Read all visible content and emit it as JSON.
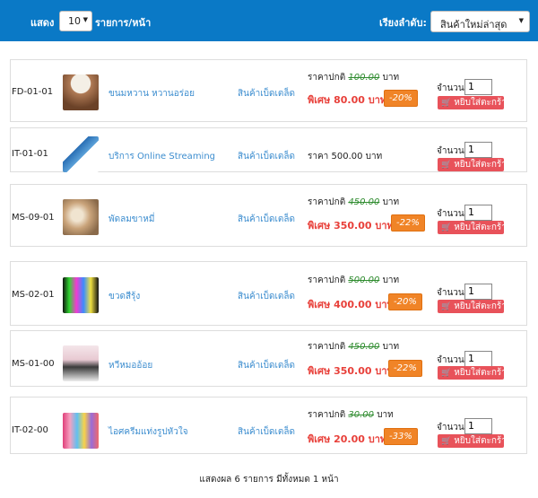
{
  "toolbar": {
    "show_label": "แสดง",
    "per_page_value": "10",
    "per_page_suffix": "รายการ/หน้า",
    "sort_label": "เรียงลำดับ:",
    "sort_value": "สินค้าใหม่ล่าสุด"
  },
  "labels": {
    "regular_price": "ราคาปกติ",
    "special_price": "พิเศษ",
    "price": "ราคา",
    "baht": "บาท",
    "quantity": "จำนวน",
    "add_to_cart": "หยิบใส่ตะกร้า"
  },
  "products": [
    {
      "code": "FD-01-01",
      "name": "ขนมหวาน หวานอร่อย",
      "category": "สินค้าเบ็ดเตล็ด",
      "regular": "100.00",
      "special": "80.00",
      "discount": "-20%",
      "qty": "1"
    },
    {
      "code": "IT-01-01",
      "name": "บริการ Online Streaming",
      "category": "สินค้าเบ็ดเตล็ด",
      "price": "500.00",
      "qty": "1"
    },
    {
      "code": "MS-09-01",
      "name": "พัดลมขาหมี่",
      "category": "สินค้าเบ็ดเตล็ด",
      "regular": "450.00",
      "special": "350.00",
      "discount": "-22%",
      "qty": "1"
    },
    {
      "code": "MS-02-01",
      "name": "ขวดสีรุ้ง",
      "category": "สินค้าเบ็ดเตล็ด",
      "regular": "500.00",
      "special": "400.00",
      "discount": "-20%",
      "qty": "1"
    },
    {
      "code": "MS-01-00",
      "name": "หวีหมออ้อย",
      "category": "สินค้าเบ็ดเตล็ด",
      "regular": "450.00",
      "special": "350.00",
      "discount": "-22%",
      "qty": "1"
    },
    {
      "code": "IT-02-00",
      "name": "ไอศครีมแท่งรูปหัวใจ",
      "category": "สินค้าเบ็ดเตล็ด",
      "regular": "30.00",
      "special": "20.00",
      "discount": "-33%",
      "qty": "1"
    }
  ],
  "footer": {
    "summary": "แสดงผล 6 รายการ มีทั้งหมด 1 หน้า"
  },
  "colors": {
    "topbar": "#0a79c6",
    "link": "#3c8dcf",
    "special": "#e8403a",
    "discount_badge": "#f08427",
    "cart_button": "#e8525a"
  },
  "icons": {
    "cart": "shopping-cart-icon",
    "dropdown": "chevron-down-icon"
  }
}
